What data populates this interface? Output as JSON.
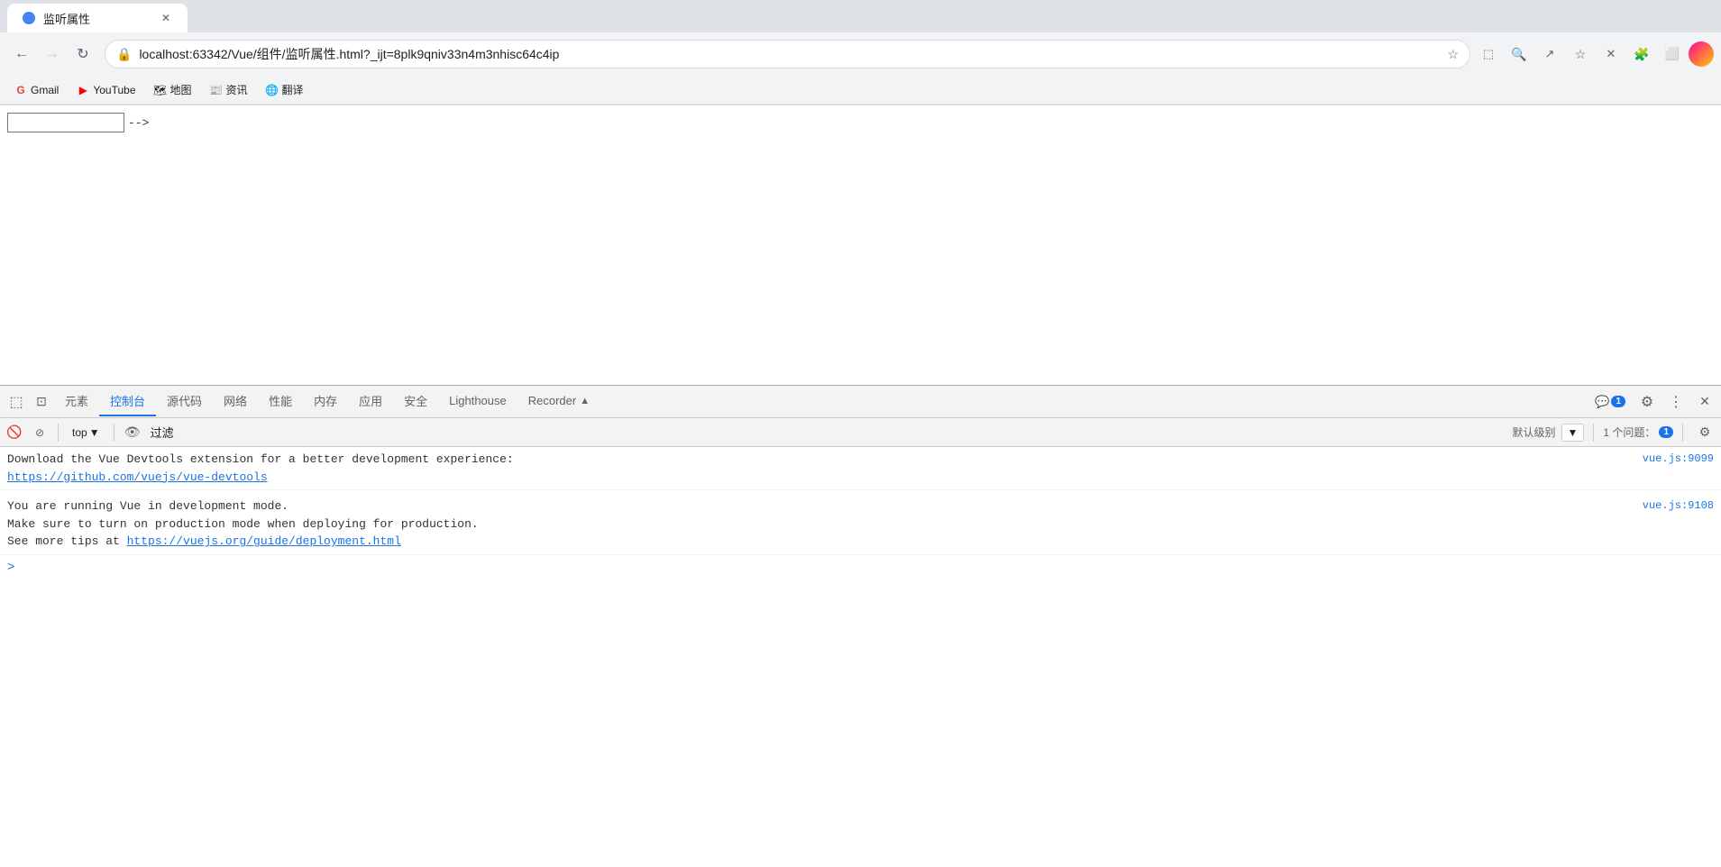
{
  "browser": {
    "tab": {
      "title": "监听属性",
      "favicon": "🔵"
    },
    "nav": {
      "url": "localhost:63342/Vue/组件/监听属性.html?_ijt=8plk9qniv33n4m3nhisc64c4ip",
      "back_disabled": false,
      "forward_disabled": true
    },
    "bookmarks": [
      {
        "label": "Gmail",
        "favicon": "G",
        "color": "#EA4335"
      },
      {
        "label": "YouTube",
        "favicon": "▶",
        "color": "#FF0000"
      },
      {
        "label": "地图",
        "favicon": "📍",
        "color": "#4285F4"
      },
      {
        "label": "资讯",
        "favicon": "📰",
        "color": "#4285F4"
      },
      {
        "label": "翻译",
        "favicon": "🌐",
        "color": "#4285F4"
      }
    ]
  },
  "page": {
    "input_value": "",
    "comment_text": "-->"
  },
  "devtools": {
    "tabs": [
      {
        "label": "元素",
        "active": false
      },
      {
        "label": "控制台",
        "active": true
      },
      {
        "label": "源代码",
        "active": false
      },
      {
        "label": "网络",
        "active": false
      },
      {
        "label": "性能",
        "active": false
      },
      {
        "label": "内存",
        "active": false
      },
      {
        "label": "应用",
        "active": false
      },
      {
        "label": "安全",
        "active": false
      },
      {
        "label": "Lighthouse",
        "active": false
      },
      {
        "label": "Recorder ▲",
        "active": false
      }
    ],
    "badge_count": "1",
    "issues_label": "1 个问题：",
    "issues_badge": "1",
    "default_level": "默认级别",
    "console": {
      "top_label": "top",
      "filter_placeholder": "过滤",
      "messages": [
        {
          "text": "Download the Vue Devtools extension for a better development experience:\nhttps://github.com/vuejs/vue-devtools",
          "link": "https://github.com/vuejs/vue-devtools",
          "source": "vue.js:9099",
          "has_link": true,
          "link_text": "https://github.com/vuejs/vue-devtools",
          "prefix_text": "Download the Vue Devtools extension for a better development experience:"
        },
        {
          "text": "You are running Vue in development mode.\nMake sure to turn on production mode when deploying for production.\nSee more tips at https://vuejs.org/guide/deployment.html",
          "source": "vue.js:9108",
          "has_link": true,
          "prefix_text": "You are running Vue in development mode.\nMake sure to turn on production mode when deploying for production.\nSee more tips at ",
          "link_text": "https://vuejs.org/guide/deployment.html",
          "link": "https://vuejs.org/guide/deployment.html"
        }
      ],
      "prompt_symbol": ">"
    }
  }
}
